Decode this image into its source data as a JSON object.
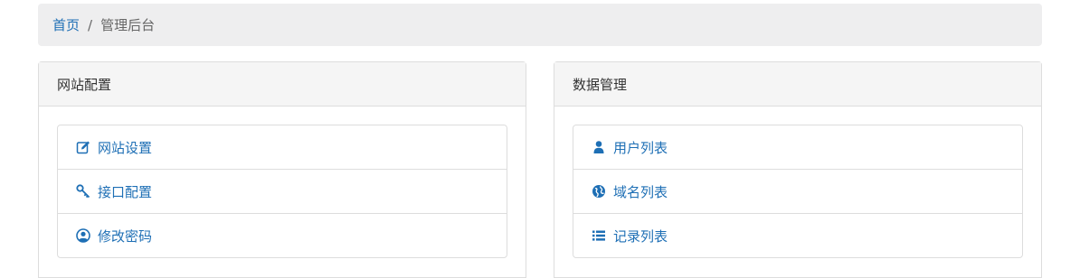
{
  "breadcrumb": {
    "home": "首页",
    "separator": "/",
    "current": "管理后台"
  },
  "left_panel": {
    "title": "网站配置",
    "items": [
      {
        "label": "网站设置",
        "icon": "edit-icon"
      },
      {
        "label": "接口配置",
        "icon": "key-icon"
      },
      {
        "label": "修改密码",
        "icon": "user-circle-icon"
      }
    ]
  },
  "right_panel": {
    "title": "数据管理",
    "items": [
      {
        "label": "用户列表",
        "icon": "user-icon"
      },
      {
        "label": "域名列表",
        "icon": "globe-icon"
      },
      {
        "label": "记录列表",
        "icon": "list-icon"
      }
    ]
  },
  "colors": {
    "link": "#1e6fb5",
    "breadcrumb_bg": "#eeeeef",
    "panel_heading_bg": "#f5f5f5",
    "border": "#dddddd"
  }
}
